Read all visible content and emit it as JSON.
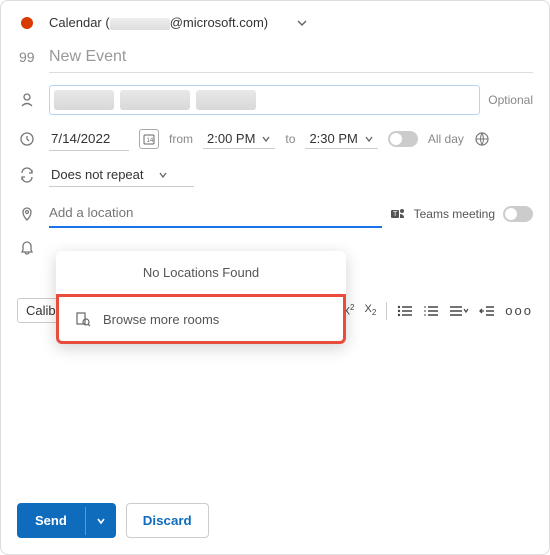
{
  "header": {
    "calendar_label": "Calendar (",
    "email_suffix": "@microsoft.com)"
  },
  "title": {
    "placeholder": "New Event"
  },
  "attendees": {
    "optional": "Optional"
  },
  "datetime": {
    "date": "7/14/2022",
    "from_label": "from",
    "start": "2:00 PM",
    "to_label": "to",
    "end": "2:30 PM",
    "allday": "All day"
  },
  "repeat": {
    "label": "Does not repeat"
  },
  "location": {
    "placeholder": "Add a location",
    "teams": "Teams meeting"
  },
  "popup": {
    "header": "No Locations Found",
    "browse": "Browse more rooms"
  },
  "toolbar": {
    "font": "Calibri"
  },
  "footer": {
    "send": "Send",
    "discard": "Discard"
  }
}
